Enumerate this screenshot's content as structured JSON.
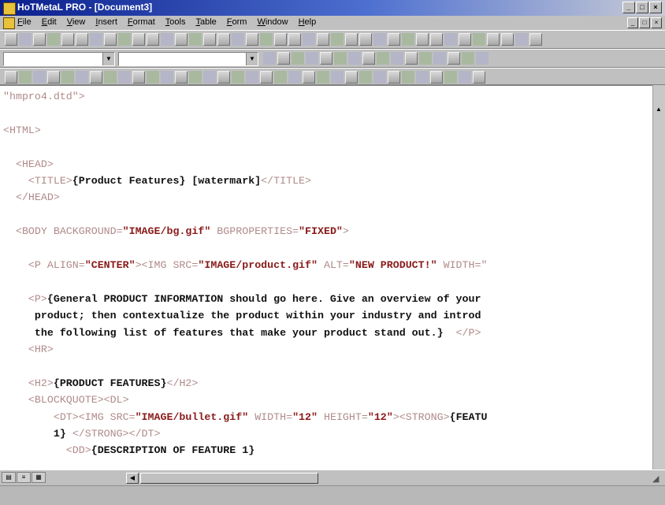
{
  "window": {
    "title": "HoTMetaL PRO - [Document3]"
  },
  "menu": [
    "File",
    "Edit",
    "View",
    "Insert",
    "Format",
    "Tools",
    "Table",
    "Form",
    "Window",
    "Help"
  ],
  "editor": {
    "lines": [
      [
        {
          "t": "\"hmpro4.dtd\">",
          "c": "tag"
        }
      ],
      [],
      [
        {
          "t": "<HTML>",
          "c": "tag"
        }
      ],
      [],
      [
        {
          "t": "  <HEAD>",
          "c": "tag"
        }
      ],
      [
        {
          "t": "    <TITLE>",
          "c": "tag"
        },
        {
          "t": "{Product Features} [watermark]",
          "c": "txt"
        },
        {
          "t": "</TITLE>",
          "c": "tag"
        }
      ],
      [
        {
          "t": "  </HEAD>",
          "c": "tag"
        }
      ],
      [],
      [
        {
          "t": "  <BODY BACKGROUND=",
          "c": "tag"
        },
        {
          "t": "\"IMAGE/bg.gif\"",
          "c": "val"
        },
        {
          "t": " BGPROPERTIES=",
          "c": "tag"
        },
        {
          "t": "\"FIXED\"",
          "c": "val"
        },
        {
          "t": ">",
          "c": "tag"
        }
      ],
      [],
      [
        {
          "t": "    <P ALIGN=",
          "c": "tag"
        },
        {
          "t": "\"CENTER\"",
          "c": "val"
        },
        {
          "t": "><IMG SRC=",
          "c": "tag"
        },
        {
          "t": "\"IMAGE/product.gif\"",
          "c": "val"
        },
        {
          "t": " ALT=",
          "c": "tag"
        },
        {
          "t": "\"NEW PRODUCT!\"",
          "c": "val"
        },
        {
          "t": " WIDTH=\"",
          "c": "tag"
        }
      ],
      [],
      [
        {
          "t": "    <P>",
          "c": "tag"
        },
        {
          "t": "{General PRODUCT INFORMATION should go here. Give an overview of your",
          "c": "txt"
        }
      ],
      [
        {
          "t": "     product; then contextualize the product within your industry and introd",
          "c": "txt"
        }
      ],
      [
        {
          "t": "     the following list of features that make your product stand out.}",
          "c": "txt"
        },
        {
          "t": "  </P>",
          "c": "tag"
        }
      ],
      [
        {
          "t": "    <HR>",
          "c": "tag"
        }
      ],
      [],
      [
        {
          "t": "    <H2>",
          "c": "tag"
        },
        {
          "t": "{PRODUCT FEATURES}",
          "c": "txt"
        },
        {
          "t": "</H2>",
          "c": "tag"
        }
      ],
      [
        {
          "t": "    <BLOCKQUOTE><DL>",
          "c": "tag"
        }
      ],
      [
        {
          "t": "        <DT><IMG SRC=",
          "c": "tag"
        },
        {
          "t": "\"IMAGE/bullet.gif\"",
          "c": "val"
        },
        {
          "t": " WIDTH=",
          "c": "tag"
        },
        {
          "t": "\"12\"",
          "c": "val"
        },
        {
          "t": " HEIGHT=",
          "c": "tag"
        },
        {
          "t": "\"12\"",
          "c": "val"
        },
        {
          "t": "><STRONG>",
          "c": "tag"
        },
        {
          "t": "{FEATU",
          "c": "txt"
        }
      ],
      [
        {
          "t": "        1}",
          "c": "txt"
        },
        {
          "t": " </STRONG></DT>",
          "c": "tag"
        }
      ],
      [
        {
          "t": "          <DD>",
          "c": "tag"
        },
        {
          "t": "{DESCRIPTION OF FEATURE 1}",
          "c": "txt"
        }
      ]
    ]
  }
}
